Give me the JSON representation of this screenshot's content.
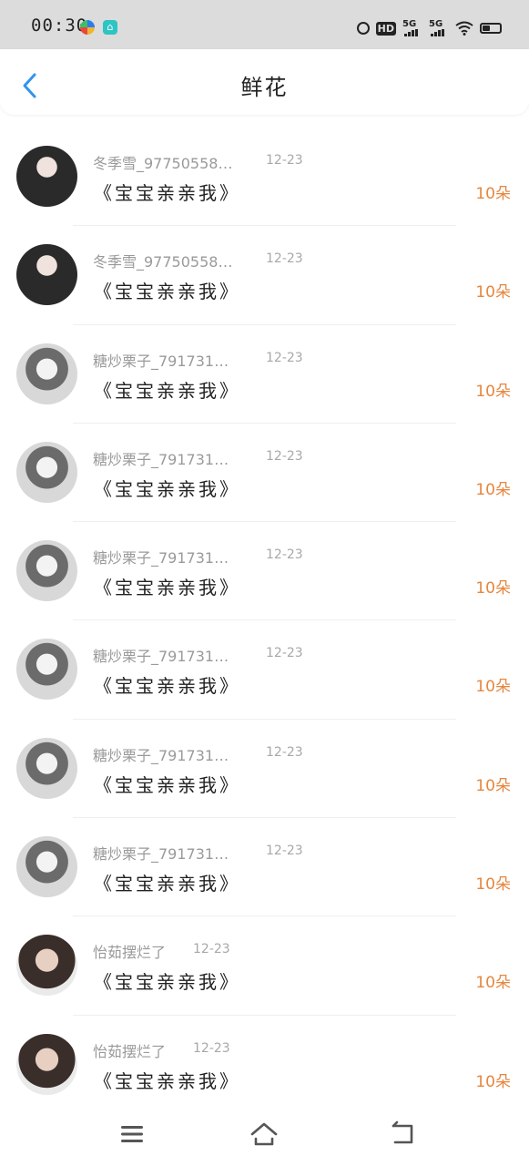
{
  "status_bar": {
    "time": "00:30",
    "hd_label": "HD",
    "net1": "5G",
    "net2": "5G"
  },
  "header": {
    "title": "鲜花"
  },
  "records": [
    {
      "user": "冬季雪_97750558…",
      "time": "12-23",
      "gift": "《宝宝亲亲我》",
      "count": "10朵",
      "avatar": "a1"
    },
    {
      "user": "冬季雪_97750558…",
      "time": "12-23",
      "gift": "《宝宝亲亲我》",
      "count": "10朵",
      "avatar": "a1"
    },
    {
      "user": "糖炒栗子_791731…",
      "time": "12-23",
      "gift": "《宝宝亲亲我》",
      "count": "10朵",
      "avatar": "a2"
    },
    {
      "user": "糖炒栗子_791731…",
      "time": "12-23",
      "gift": "《宝宝亲亲我》",
      "count": "10朵",
      "avatar": "a2"
    },
    {
      "user": "糖炒栗子_791731…",
      "time": "12-23",
      "gift": "《宝宝亲亲我》",
      "count": "10朵",
      "avatar": "a2"
    },
    {
      "user": "糖炒栗子_791731…",
      "time": "12-23",
      "gift": "《宝宝亲亲我》",
      "count": "10朵",
      "avatar": "a2"
    },
    {
      "user": "糖炒栗子_791731…",
      "time": "12-23",
      "gift": "《宝宝亲亲我》",
      "count": "10朵",
      "avatar": "a2"
    },
    {
      "user": "糖炒栗子_791731…",
      "time": "12-23",
      "gift": "《宝宝亲亲我》",
      "count": "10朵",
      "avatar": "a2"
    },
    {
      "user": "怡茹摆烂了",
      "time": "12-23",
      "gift": "《宝宝亲亲我》",
      "count": "10朵",
      "avatar": "a3"
    },
    {
      "user": "怡茹摆烂了",
      "time": "12-23",
      "gift": "《宝宝亲亲我》",
      "count": "10朵",
      "avatar": "a3"
    }
  ],
  "colors": {
    "accent_blue": "#2f95f0",
    "count_orange": "#e6863e"
  },
  "icons": {
    "back": "chevron-left-icon",
    "nav_menu": "menu-icon",
    "nav_home": "home-icon",
    "nav_back": "return-icon"
  }
}
